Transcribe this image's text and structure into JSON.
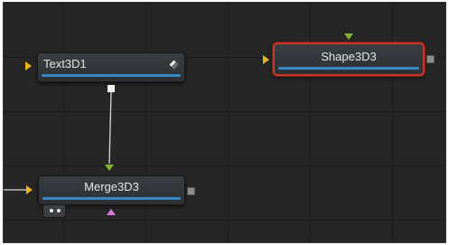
{
  "nodes": {
    "text3d": {
      "label": "Text3D1"
    },
    "shape3d": {
      "label": "Shape3D3",
      "selected": true
    },
    "merge3d": {
      "label": "Merge3D3"
    }
  },
  "colors": {
    "background": "#262626",
    "node_bar": "#3b88c8",
    "selection": "#c8382b",
    "input_main": "#e6b41e",
    "input_secondary": "#86b534",
    "input_effect": "#d27fcf"
  }
}
